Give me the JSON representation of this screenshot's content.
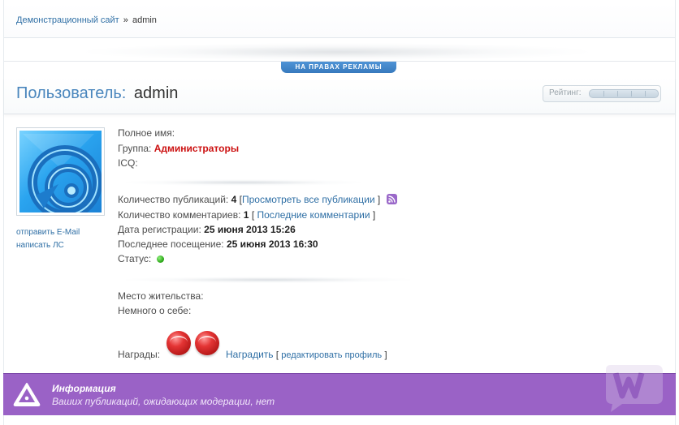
{
  "breadcrumb": {
    "home": "Демонстрационный сайт",
    "separator": "»",
    "current": "admin"
  },
  "ad": {
    "label": "НА ПРАВАХ РЕКЛАМЫ"
  },
  "profile": {
    "title_prefix": "Пользователь:",
    "username": "admin",
    "rating_label": "Рейтинг:",
    "side_links": {
      "email": "отправить E-Mail",
      "pm": "написать ЛС"
    },
    "fields": {
      "fullname_label": "Полное имя:",
      "group_label": "Группа:",
      "group_value": "Администраторы",
      "icq_label": "ICQ:",
      "pubs_label": "Количество публикаций:",
      "pubs_value": "4",
      "pubs_link": "Просмотреть все публикации",
      "comments_label": "Количество комментариев:",
      "comments_value": "1",
      "comments_link": "Последние комментарии",
      "reg_label": "Дата регистрации:",
      "reg_value": "25 июня 2013 15:26",
      "visit_label": "Последнее посещение:",
      "visit_value": "25 июня 2013 16:30",
      "status_label": "Статус:",
      "location_label": "Место жительства:",
      "about_label": "Немного о себе:",
      "awards_label": "Награды:",
      "award_link": "Наградить",
      "edit_link": "редактировать профиль"
    }
  },
  "notice": {
    "title": "Информация",
    "text": "Ваших публикаций, ожидающих модерации, нет"
  },
  "colors": {
    "accent_blue": "#4a86bd",
    "link": "#2f6fa5",
    "admin_group": "#cc1111",
    "notice_bg": "#9a62c6",
    "status_online": "#25a012"
  },
  "icons": {
    "rss": "rss-icon",
    "status": "status-online-icon",
    "notice": "warning-triangle-icon",
    "award": "award-medal-icon"
  }
}
